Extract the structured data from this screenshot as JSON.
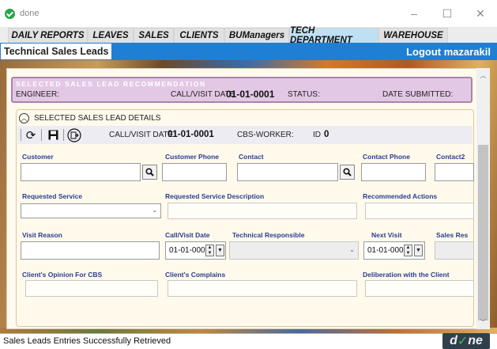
{
  "window": {
    "title": "done",
    "controls": [
      "–",
      "☐",
      "✕"
    ]
  },
  "tabs": [
    {
      "label": "DAILY REPORTS"
    },
    {
      "label": "LEAVES"
    },
    {
      "label": "SALES"
    },
    {
      "label": "CLIENTS"
    },
    {
      "label": "BUManagers"
    },
    {
      "label": "TECH DEPARTMENT",
      "active": true
    },
    {
      "label": "WAREHOUSE"
    }
  ],
  "header": {
    "title": "Technical Sales Leads",
    "logout": "Logout mazarakil"
  },
  "recommendation": {
    "legend": "SELECTED SALES LEAD RECOMMENDATION",
    "engineer_label": "ENGINEER:",
    "visit_date_label": "CALL/VISIT DATE",
    "visit_date_value": "01-01-0001",
    "status_label": "STATUS:",
    "date_submitted_label": "DATE SUBMITTED:"
  },
  "details": {
    "title": "SELECTED SALES LEAD DETAILS",
    "toolbar": {
      "visit_date_label": "CALL/VISIT DATE:",
      "visit_date_value": "01-01-0001",
      "worker_label": "CBS-WORKER:",
      "id_label": "ID",
      "id_value": "0"
    },
    "labels": {
      "customer": "Customer",
      "customer_phone": "Customer Phone",
      "contact": "Contact",
      "contact_phone": "Contact Phone",
      "contact2": "Contact2",
      "requested_service": "Requested Service",
      "requested_service_desc": "Requested Service Description",
      "recommended_actions": "Recommended Actions",
      "visit_reason": "Visit Reason",
      "call_visit_date": "Call/Visit Date",
      "technical_responsible": "Technical Responsible",
      "next_visit": "Next Visit",
      "sales_res": "Sales Res",
      "clients_opinion": "Client's Opinion For CBS",
      "clients_complains": "Client's Complains",
      "deliberation": "Deliberation with the Client"
    },
    "values": {
      "call_visit_date": "01-01-0001",
      "next_visit": "01-01-0001"
    }
  },
  "status": {
    "message": "Sales Leads Entries Successfully Retrieved"
  },
  "logo": {
    "text_d": "d",
    "text_o": "✓",
    "text_ne": "ne"
  }
}
